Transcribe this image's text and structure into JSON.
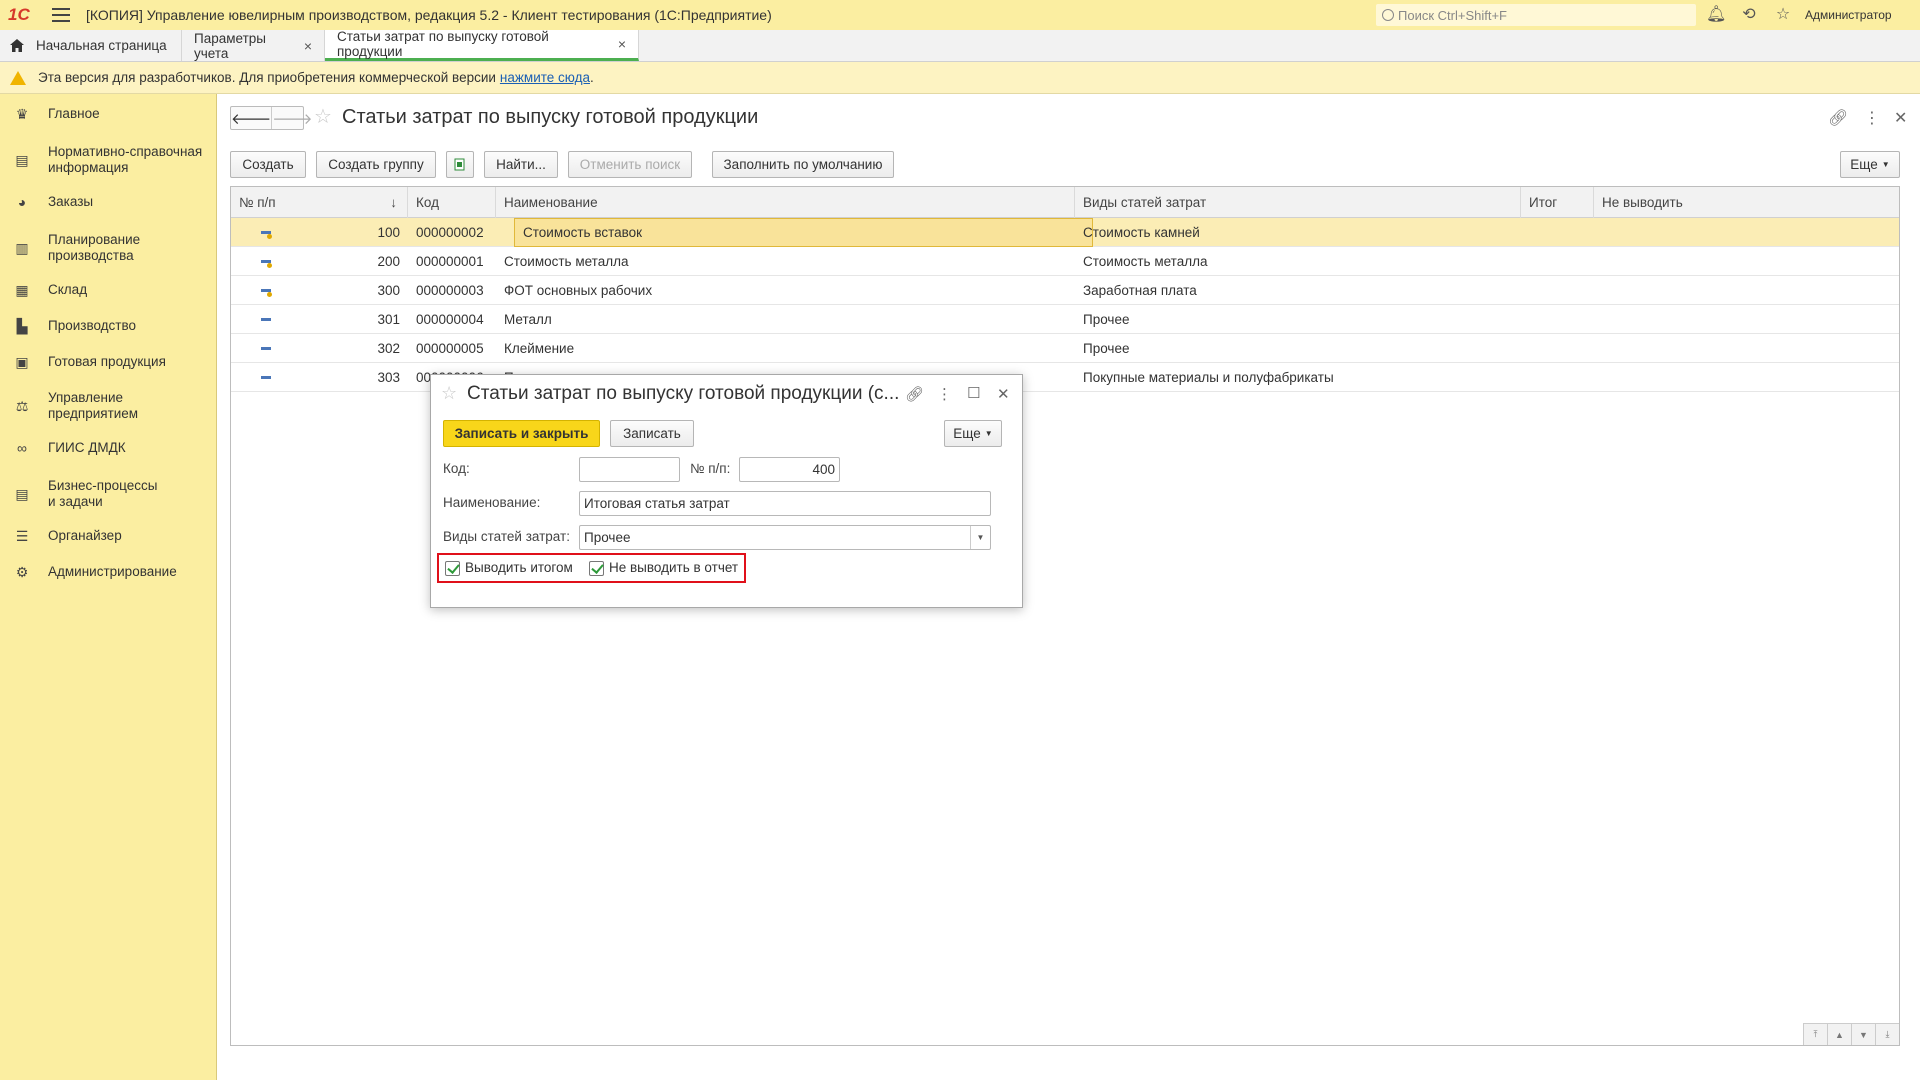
{
  "titlebar": {
    "logo": "1С",
    "title": "[КОПИЯ] Управление ювелирным производством, редакция 5.2  - Клиент тестирования (1С:Предприятие)",
    "search_placeholder": "Поиск Ctrl+Shift+F",
    "user": "Администратор"
  },
  "tabs": [
    {
      "label": "Начальная страница"
    },
    {
      "label": "Параметры учета",
      "close": "×"
    },
    {
      "label": "Статьи затрат по выпуску готовой продукции",
      "close": "×"
    }
  ],
  "notice": {
    "text": "Эта версия для разработчиков. Для приобретения коммерческой версии",
    "link": "нажмите сюда",
    "tail": "."
  },
  "sidebar": {
    "items": [
      {
        "label": "Главное",
        "icon": "crown-icon"
      },
      {
        "label": "Нормативно-справочная\nинформация",
        "icon": "book-icon"
      },
      {
        "label": "Заказы",
        "icon": "pie-icon"
      },
      {
        "label": "Планирование\nпроизводства",
        "icon": "clipboard-icon"
      },
      {
        "label": "Склад",
        "icon": "grid-icon"
      },
      {
        "label": "Производство",
        "icon": "factory-icon"
      },
      {
        "label": "Готовая продукция",
        "icon": "bag-icon"
      },
      {
        "label": "Управление\nпредприятием",
        "icon": "org-icon"
      },
      {
        "label": "ГИИС ДМДК",
        "icon": "link-icon"
      },
      {
        "label": "Бизнес-процессы\nи задачи",
        "icon": "process-icon"
      },
      {
        "label": "Органайзер",
        "icon": "organizer-icon"
      },
      {
        "label": "Администрирование",
        "icon": "gear-icon"
      }
    ]
  },
  "main": {
    "title": "Статьи затрат по выпуску готовой продукции",
    "toolbar": {
      "create": "Создать",
      "create_group": "Создать группу",
      "find": "Найти...",
      "cancel_search": "Отменить поиск",
      "fill_default": "Заполнить по умолчанию",
      "more": "Еще"
    },
    "table": {
      "columns": [
        "№ п/п",
        "Код",
        "Наименование",
        "Виды статей затрат",
        "Итог",
        "Не выводить"
      ],
      "sort_indicator": "↓",
      "rows": [
        {
          "num": "100",
          "code": "000000002",
          "name": "Стоимость вставок",
          "kind": "Стоимость камней"
        },
        {
          "num": "200",
          "code": "000000001",
          "name": "Стоимость металла",
          "kind": "Стоимость металла"
        },
        {
          "num": "300",
          "code": "000000003",
          "name": "ФОТ основных рабочих",
          "kind": "Заработная плата"
        },
        {
          "num": "301",
          "code": "000000004",
          "name": "Металл",
          "kind": "Прочее"
        },
        {
          "num": "302",
          "code": "000000005",
          "name": "Клеймение",
          "kind": "Прочее"
        },
        {
          "num": "303",
          "code": "000000006",
          "name": "П",
          "kind": "Покупные материалы и полуфабрикаты"
        }
      ]
    }
  },
  "dialog": {
    "title": "Статьи затрат по выпуску готовой продукции (с...",
    "save_close": "Записать и закрыть",
    "save": "Записать",
    "more": "Еще",
    "code_label": "Код:",
    "code_value": "",
    "num_label": "№ п/п:",
    "num_value": "400",
    "name_label": "Наименование:",
    "name_value": "Итоговая статья затрат",
    "kind_label": "Виды статей затрат:",
    "kind_value": "Прочее",
    "chk_total": "Выводить итогом",
    "chk_total_checked": true,
    "chk_hide": "Не выводить в отчет",
    "chk_hide_checked": true
  }
}
